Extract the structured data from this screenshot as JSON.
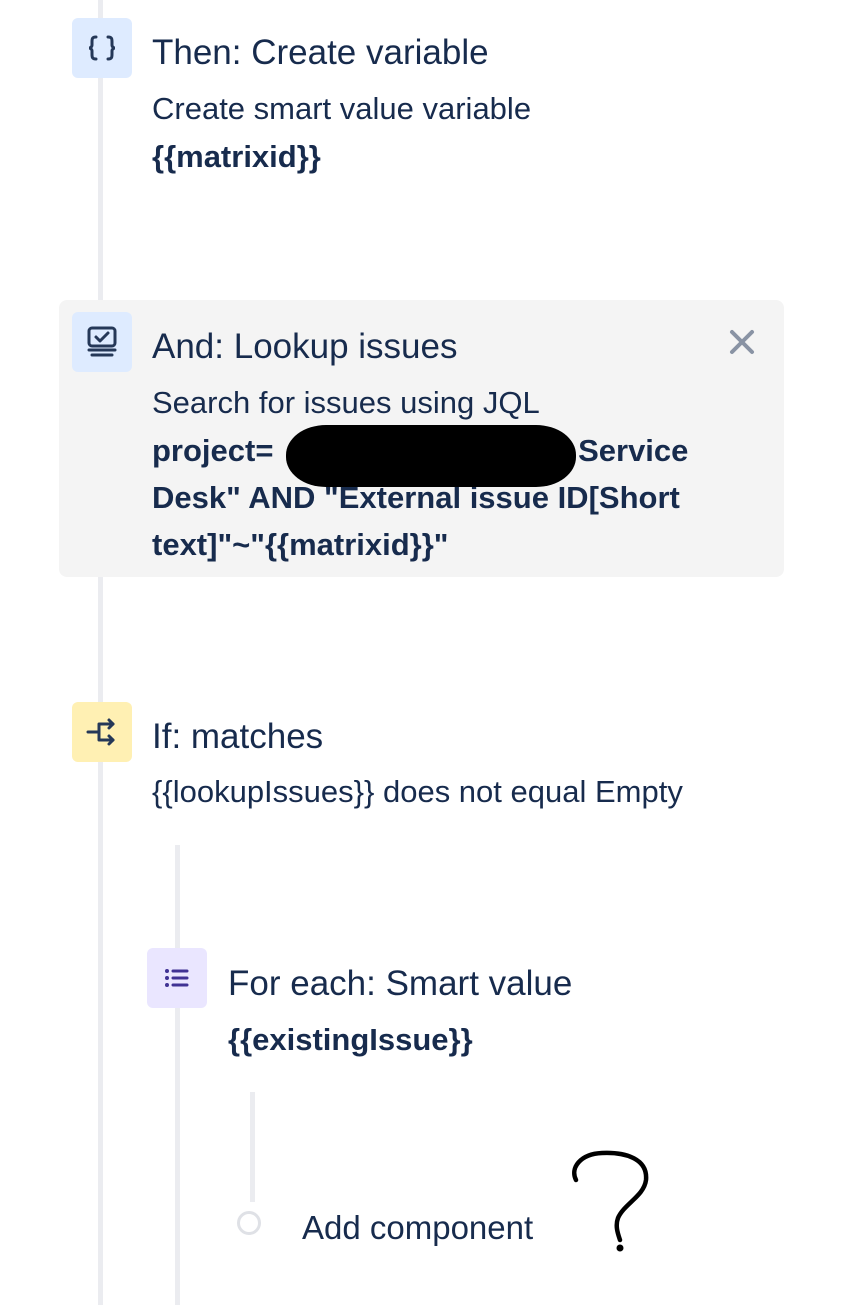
{
  "steps": {
    "create_variable": {
      "title": "Then: Create variable",
      "description": "Create smart value variable",
      "value": "{{matrixid}}",
      "icon": "braces-icon",
      "icon_color": "#deebff"
    },
    "lookup_issues": {
      "title": "And: Lookup issues",
      "description": "Search for issues using JQL",
      "value_prefix": "project=",
      "value_rest": " Service Desk\" AND \"External issue ID[Short text]\"~\"{{matrixid}}\"",
      "icon": "lookup-issues-icon",
      "icon_color": "#deebff",
      "selected": true
    },
    "if_matches": {
      "title": "If: matches",
      "description": "{{lookupIssues}} does not equal Empty",
      "icon": "branch-icon",
      "icon_color": "#fff0b3"
    },
    "for_each": {
      "title": "For each: Smart value",
      "value": "{{existingIssue}}",
      "icon": "list-icon",
      "icon_color": "#eae6ff"
    }
  },
  "add_component": {
    "label": "Add component"
  },
  "colors": {
    "text": "#172b4d",
    "selected_bg": "#f4f4f4",
    "rail": "#ebecf0",
    "close_icon": "#8993a4"
  }
}
